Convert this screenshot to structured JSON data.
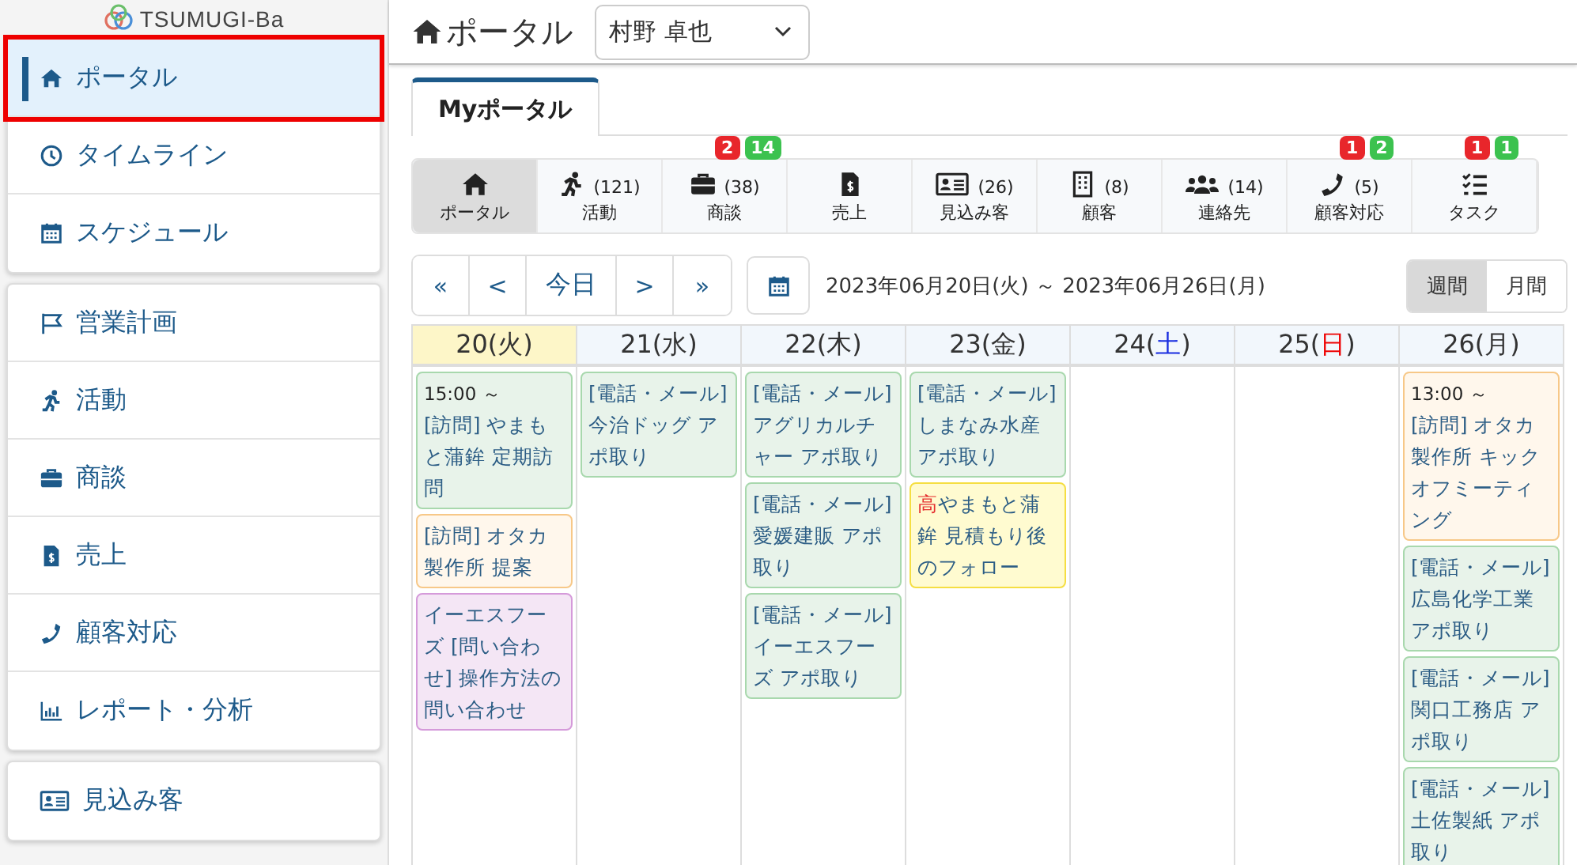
{
  "sidebar": {
    "logo": "TSUMUGI-Ba",
    "groups": [
      {
        "items": [
          {
            "label": "ポータル",
            "selected": true,
            "highlighted": true
          },
          {
            "label": "タイムライン",
            "selected": false,
            "highlighted": false
          },
          {
            "label": "スケジュール",
            "selected": false,
            "highlighted": false
          }
        ]
      },
      {
        "items": [
          {
            "label": "営業計画",
            "selected": false,
            "highlighted": false
          },
          {
            "label": "活動",
            "selected": false,
            "highlighted": false
          },
          {
            "label": "商談",
            "selected": false,
            "highlighted": false
          },
          {
            "label": "売上",
            "selected": false,
            "highlighted": false
          },
          {
            "label": "顧客対応",
            "selected": false,
            "highlighted": false
          },
          {
            "label": "レポート・分析",
            "selected": false,
            "highlighted": false
          }
        ]
      },
      {
        "items": [
          {
            "label": "見込み客",
            "selected": false,
            "highlighted": false
          }
        ]
      }
    ]
  },
  "header": {
    "title": "ポータル",
    "user_select": {
      "value": "村野 卓也"
    }
  },
  "tabs": [
    {
      "label": "Myポータル",
      "selected": true
    }
  ],
  "toolbar": [
    {
      "label": "ポータル",
      "selected": true
    },
    {
      "label": "活動",
      "count": "(121)",
      "selected": false
    },
    {
      "label": "商談",
      "count": "(38)",
      "alert": "2",
      "new": "14",
      "selected": false
    },
    {
      "label": "売上",
      "selected": false
    },
    {
      "label": "見込み客",
      "count": "(26)",
      "selected": false
    },
    {
      "label": "顧客",
      "count": "(8)",
      "selected": false
    },
    {
      "label": "連絡先",
      "count": "(14)",
      "selected": false
    },
    {
      "label": "顧客対応",
      "count": "(5)",
      "alert": "1",
      "new": "2",
      "selected": false
    },
    {
      "label": "タスク",
      "alert": "1",
      "new": "1",
      "selected": false
    }
  ],
  "calendar": {
    "nav": [
      "«",
      "<",
      "今日",
      ">",
      "»"
    ],
    "range": "2023年06月20日(火) ～ 2023年06月26日(月)",
    "views": [
      {
        "label": "週間",
        "selected": true
      },
      {
        "label": "月間",
        "selected": false
      }
    ],
    "days": [
      {
        "prefix": "20(",
        "weekday": "火",
        "suffix": ")",
        "kind": "weekday",
        "today": true,
        "events": [
          {
            "kind": "visit-done",
            "time": "15:00 ～",
            "text": "[訪問] やまもと蒲鉾 定期訪問"
          },
          {
            "kind": "visit",
            "text": "[訪問] オタカ製作所 提案"
          },
          {
            "kind": "inquiry",
            "text": "イーエスフーズ [問い合わせ] 操作方法の問い合わせ"
          }
        ]
      },
      {
        "prefix": "21(",
        "weekday": "水",
        "suffix": ")",
        "kind": "weekday",
        "today": false,
        "events": [
          {
            "kind": "visit-done",
            "text": "[電話・メール] 今治ドッグ アポ取り"
          }
        ]
      },
      {
        "prefix": "22(",
        "weekday": "木",
        "suffix": ")",
        "kind": "weekday",
        "today": false,
        "events": [
          {
            "kind": "visit-done",
            "text": "[電話・メール] アグリカルチャー アポ取り"
          },
          {
            "kind": "visit-done",
            "text": "[電話・メール] 愛媛建販 アポ取り"
          },
          {
            "kind": "visit-done",
            "text": "[電話・メール] イーエスフーズ アポ取り"
          }
        ]
      },
      {
        "prefix": "23(",
        "weekday": "金",
        "suffix": ")",
        "kind": "weekday",
        "today": false,
        "events": [
          {
            "kind": "visit-done",
            "text": "[電話・メール] しまなみ水産アポ取り"
          },
          {
            "kind": "task",
            "priority": "高",
            "text": "やまもと蒲鉾 見積もり後のフォロー"
          }
        ]
      },
      {
        "prefix": "24(",
        "weekday": "土",
        "suffix": ")",
        "kind": "saturday",
        "today": false
      },
      {
        "prefix": "25(",
        "weekday": "日",
        "suffix": ")",
        "kind": "sunday",
        "today": false
      },
      {
        "prefix": "26(",
        "weekday": "月",
        "suffix": ")",
        "kind": "weekday",
        "today": false,
        "events": [
          {
            "kind": "visit",
            "time": "13:00 ～",
            "text": "[訪問] オタカ製作所 キックオフミーティング"
          },
          {
            "kind": "visit-done",
            "text": "[電話・メール] 広島化学工業アポ取り"
          },
          {
            "kind": "visit-done",
            "text": "[電話・メール] 関口工務店 アポ取り"
          },
          {
            "kind": "visit-done",
            "text": "[電話・メール] 土佐製紙 アポ取り"
          }
        ]
      }
    ]
  }
}
